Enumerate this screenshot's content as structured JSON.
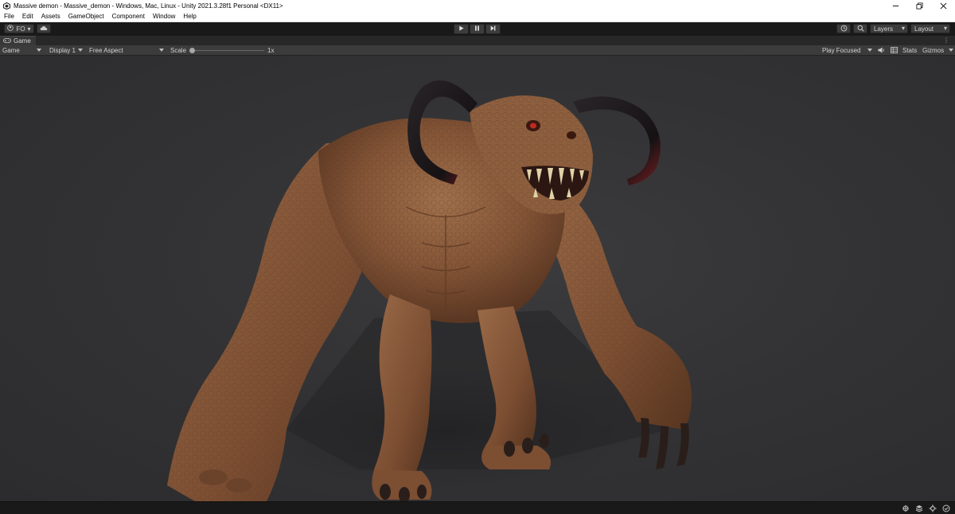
{
  "window": {
    "title": "Massive demon - Massive_demon - Windows, Mac, Linux - Unity 2021.3.28f1 Personal <DX11>"
  },
  "menu": {
    "items": [
      "File",
      "Edit",
      "Assets",
      "GameObject",
      "Component",
      "Window",
      "Help"
    ]
  },
  "toolbar": {
    "account_label": "FO",
    "layers_label": "Layers",
    "layout_label": "Layout"
  },
  "tab": {
    "label": "Game"
  },
  "game_controls": {
    "mode": "Game",
    "display": "Display 1",
    "aspect": "Free Aspect",
    "scale_label": "Scale",
    "scale_value": "1x",
    "play_mode": "Play Focused",
    "stats_label": "Stats",
    "gizmos_label": "Gizmos"
  },
  "icons": {
    "play": "play-icon",
    "pause": "pause-icon",
    "step": "step-icon",
    "history": "history-icon",
    "search": "search-icon",
    "cloud": "cloud-icon",
    "audio": "speaker-icon",
    "stats_grid": "grid-icon"
  },
  "colors": {
    "editor_bg": "#191919",
    "panel_bg": "#3c3c3c",
    "viewport_bg": "#333335",
    "creature_skin": "#8a5a3a",
    "horn": "#1e1a1c"
  }
}
